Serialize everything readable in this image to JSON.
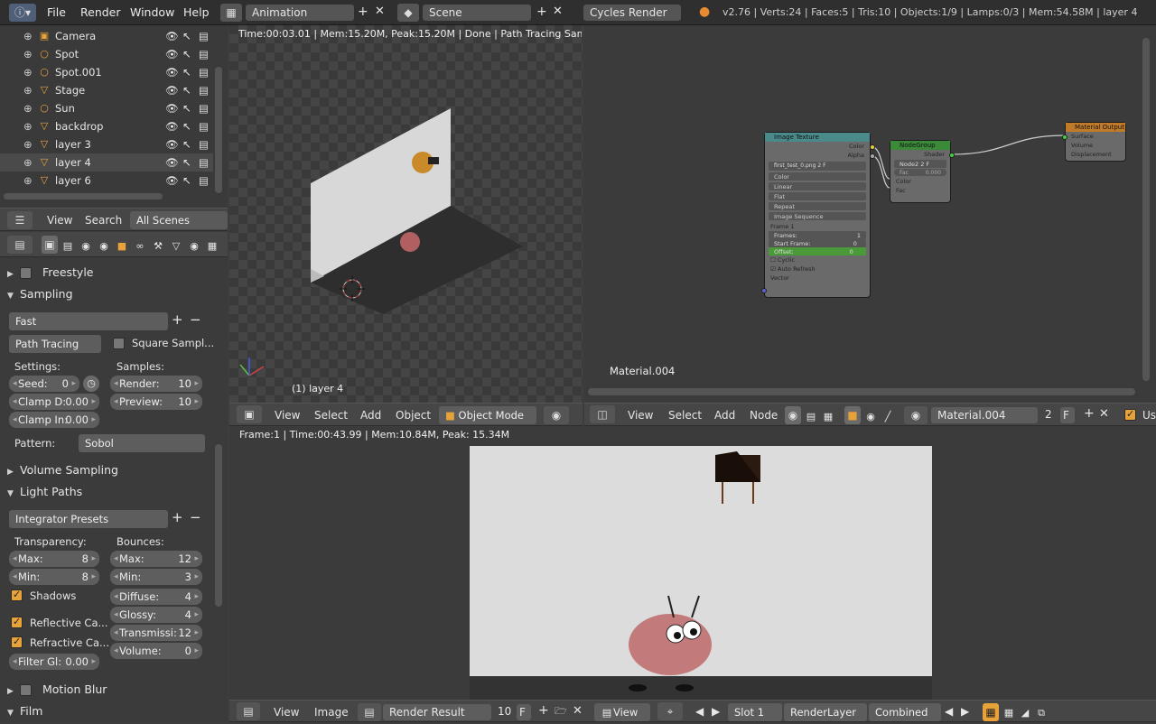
{
  "topbar": {
    "menus": [
      "File",
      "Render",
      "Window",
      "Help"
    ],
    "screen_layout": "Animation",
    "scene": "Scene",
    "engine": "Cycles Render",
    "stats": "v2.76 | Verts:24 | Faces:5 | Tris:10 | Objects:1/9 | Lamps:0/3 | Mem:54.58M | layer 4"
  },
  "outliner": {
    "items": [
      {
        "name": "Camera",
        "icon": "camera-icon"
      },
      {
        "name": "Spot",
        "icon": "lamp-icon"
      },
      {
        "name": "Spot.001",
        "icon": "lamp-icon"
      },
      {
        "name": "Stage",
        "icon": "mesh-icon"
      },
      {
        "name": "Sun",
        "icon": "lamp-icon"
      },
      {
        "name": "backdrop",
        "icon": "mesh-icon"
      },
      {
        "name": "layer 3",
        "icon": "mesh-icon"
      },
      {
        "name": "layer 4",
        "icon": "mesh-icon"
      },
      {
        "name": "layer 6",
        "icon": "mesh-icon"
      }
    ],
    "header": {
      "view": "View",
      "search": "Search",
      "filter": "All Scenes"
    }
  },
  "properties": {
    "freestyle": "Freestyle",
    "sampling": "Sampling",
    "sampling_preset": "Fast",
    "integrator": "Path Tracing",
    "square_samples": "Square Sampl...",
    "settings_label": "Settings:",
    "samples_label": "Samples:",
    "seed_label": "Seed:",
    "seed": "0",
    "clamp_d_label": "Clamp D:",
    "clamp_d": "0.00",
    "clamp_i_label": "Clamp In:",
    "clamp_i": "0.00",
    "render_label": "Render:",
    "render": "10",
    "preview_label": "Preview:",
    "preview": "10",
    "pattern_label": "Pattern:",
    "pattern": "Sobol",
    "volume_sampling": "Volume Sampling",
    "light_paths": "Light Paths",
    "integrator_presets": "Integrator Presets",
    "transparency_label": "Transparency:",
    "bounces_label": "Bounces:",
    "t_max_label": "Max:",
    "t_max": "8",
    "t_min_label": "Min:",
    "t_min": "8",
    "b_max_label": "Max:",
    "b_max": "12",
    "b_min_label": "Min:",
    "b_min": "3",
    "shadows": "Shadows",
    "diffuse_label": "Diffuse:",
    "diffuse": "4",
    "glossy_label": "Glossy:",
    "glossy": "4",
    "transmission_label": "Transmissi:",
    "transmission": "12",
    "volume_label": "Volume:",
    "volume": "0",
    "reflective": "Reflective Ca...",
    "refractive": "Refractive Ca...",
    "filter_label": "Filter Gl:",
    "filter": "0.00",
    "motion_blur": "Motion Blur",
    "film": "Film"
  },
  "viewport": {
    "status": "Time:00:03.01 | Mem:15.20M, Peak:15.20M | Done | Path Tracing Sample 1",
    "object_label": "(1) layer 4",
    "header": {
      "view": "View",
      "select": "Select",
      "add": "Add",
      "object": "Object",
      "mode": "Object Mode"
    }
  },
  "node_editor": {
    "material_label": "Material.004",
    "header": {
      "view": "View",
      "select": "Select",
      "add": "Add",
      "node": "Node",
      "material": "Material.004",
      "users": "2",
      "fake": "F",
      "use_nodes": "Use"
    },
    "image_texture": {
      "title": "Image Texture",
      "out_color": "Color",
      "out_alpha": "Alpha",
      "image": "first_test_0.png",
      "image_users": "2",
      "fake": "F",
      "rows": [
        "Color",
        "Linear",
        "Flat",
        "Repeat",
        "Image Sequence"
      ],
      "frame": "Frame 1",
      "frames_label": "Frames:",
      "frames": "1",
      "start_label": "Start Frame:",
      "start": "0",
      "offset_label": "Offset:",
      "offset": "0",
      "cyclic": "Cyclic",
      "auto_refresh": "Auto Refresh",
      "vector": "Vector"
    },
    "node_group": {
      "title": "NodeGroup",
      "shader": "Shader",
      "tree": "Node2",
      "tree_users": "2",
      "fake": "F",
      "fac_label": "Fac",
      "fac": "0.000",
      "color": "Color",
      "fac2": "Fac"
    },
    "material_output": {
      "title": "Material Output",
      "surface": "Surface",
      "volume": "Volume",
      "displacement": "Displacement"
    }
  },
  "image_editor": {
    "status": "Frame:1 | Time:00:43.99 | Mem:10.84M, Peak: 15.34M",
    "header": {
      "view": "View",
      "image": "Image",
      "image_name": "Render Result",
      "image_users": "10",
      "fake": "F",
      "view2": "View",
      "slot": "Slot 1",
      "layer": "RenderLayer",
      "pass": "Combined"
    }
  }
}
